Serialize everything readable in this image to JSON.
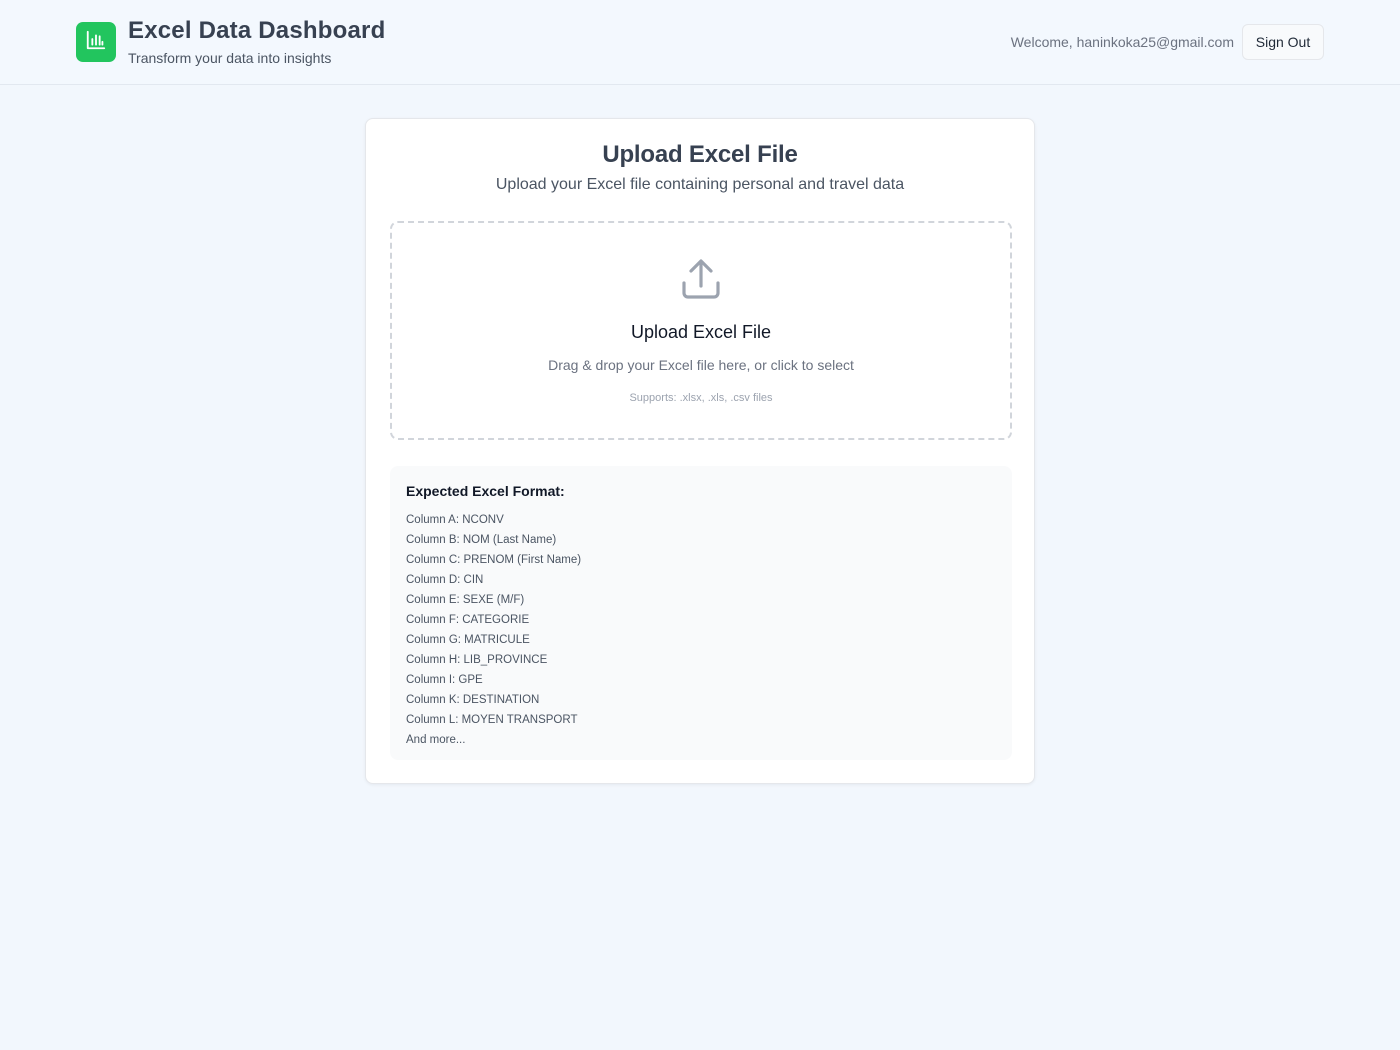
{
  "header": {
    "title": "Excel Data Dashboard",
    "subtitle": "Transform your data into insights",
    "welcome": "Welcome, haninkoka25@gmail.com",
    "sign_out_label": "Sign Out",
    "logo_icon": "bar-chart-icon",
    "logo_color": "#22c55e"
  },
  "card": {
    "title": "Upload Excel File",
    "subtitle": "Upload your Excel file containing personal and travel data"
  },
  "dropzone": {
    "icon": "upload-icon",
    "title": "Upload Excel File",
    "text": "Drag & drop your Excel file here, or click to select",
    "supports": "Supports: .xlsx, .xls, .csv files"
  },
  "format": {
    "title": "Expected Excel Format:",
    "items": [
      "Column A: NCONV",
      "Column B: NOM (Last Name)",
      "Column C: PRENOM (First Name)",
      "Column D: CIN",
      "Column E: SEXE (M/F)",
      "Column F: CATEGORIE",
      "Column G: MATRICULE",
      "Column H: LIB_PROVINCE",
      "Column I: GPE",
      "Column K: DESTINATION",
      "Column L: MOYEN TRANSPORT",
      "And more..."
    ]
  }
}
